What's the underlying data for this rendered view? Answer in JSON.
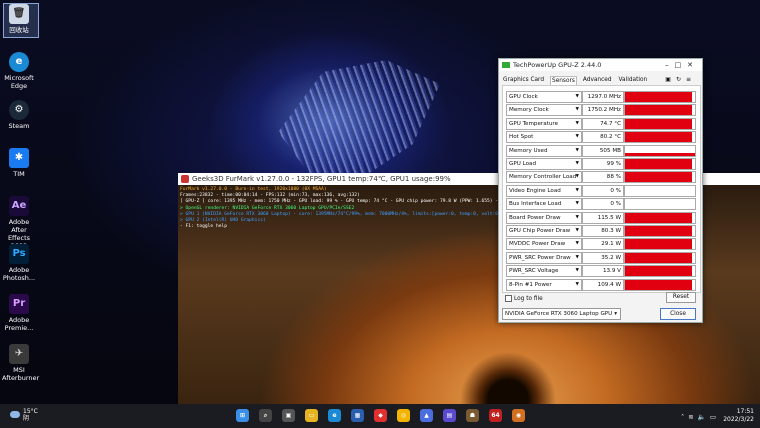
{
  "desktop": {
    "icons": [
      {
        "label": "回收站",
        "icon": "recycle-bin-icon"
      },
      {
        "label": "Microsoft Edge",
        "icon": "edge-icon",
        "color": "#1a8ad4"
      },
      {
        "label": "Steam",
        "icon": "steam-icon",
        "color": "#1b2838"
      },
      {
        "label": "TIM",
        "icon": "tim-icon",
        "color": "#1a7af0"
      },
      {
        "label": "Adobe After Effects 2022",
        "icon": "after-effects-icon",
        "color": "#1a0a3a",
        "glyph": "Ae"
      },
      {
        "label": "Adobe Photosh...",
        "icon": "photoshop-icon",
        "color": "#001e36",
        "glyph": "Ps"
      },
      {
        "label": "Adobe Premie...",
        "icon": "premiere-icon",
        "color": "#2a0a4a",
        "glyph": "Pr"
      },
      {
        "label": "MSI Afterburner",
        "icon": "msi-afterburner-icon",
        "color": "#444"
      }
    ]
  },
  "furmark": {
    "title": "Geeks3D FurMark v1.27.0.0 - 132FPS, GPU1 temp:74℃, GPU1 usage:99%",
    "osd": [
      {
        "text": "FurMark v1.27.0.0 - Burn-in test, 1920x1080 (0X MSAA)",
        "color": "#ffb030"
      },
      {
        "text": "Frames:23832 - time:00:04:14 - FPS:132 (min:73, max:136, avg:132)",
        "color": "#ffffff"
      },
      {
        "text": "[ GPU-Z ] core: 1395 MHz - mem: 1750 MHz - GPU load: 99 % - GPU temp: 74 °C - GPU chip power: 79.8 W (PPW: 1.655) - Board power: 115.8 W (PPW: 1.1",
        "color": "#ffffff"
      },
      {
        "text": "> OpenGL renderer: NVIDIA GeForce RTX 3060 Laptop GPU/PCIe/SSE2",
        "color": "#40ff80"
      },
      {
        "text": "> GPU 1 (NVIDIA GeForce RTX 3060 Laptop) - core: 1395MHz/74°C/99%, mem: 7000MHz/4%, limits:[power:0, temp:0, volt:0, OV:0]",
        "color": "#40a0ff"
      },
      {
        "text": "> GPU 2 (Intel(R) UHD Graphics)",
        "color": "#40a0ff"
      },
      {
        "text": "- F1: toggle help",
        "color": "#ffffff"
      }
    ]
  },
  "gpuz": {
    "title": "TechPowerUp GPU-Z 2.44.0",
    "tabs": [
      "Graphics Card",
      "Sensors",
      "Advanced",
      "Validation"
    ],
    "active_tab": "Sensors",
    "sensors": [
      {
        "label": "GPU Clock",
        "value": "1297.0 MHz",
        "fill": 0.95
      },
      {
        "label": "Memory Clock",
        "value": "1750.2 MHz",
        "fill": 0.95
      },
      {
        "label": "GPU Temperature",
        "value": "74.7 °C",
        "fill": 0.95
      },
      {
        "label": "Hot Spot",
        "value": "80.2 °C",
        "fill": 0.95
      },
      {
        "label": "Memory Used",
        "value": "505 MB",
        "fill": 0.08
      },
      {
        "label": "GPU Load",
        "value": "99 %",
        "fill": 0.95
      },
      {
        "label": "Memory Controller Load",
        "value": "88 %",
        "fill": 0.95
      },
      {
        "label": "Video Engine Load",
        "value": "0 %",
        "fill": 0
      },
      {
        "label": "Bus Interface Load",
        "value": "0 %",
        "fill": 0
      },
      {
        "label": "Board Power Draw",
        "value": "115.5 W",
        "fill": 0.95
      },
      {
        "label": "GPU Chip Power Draw",
        "value": "80.3 W",
        "fill": 0.95
      },
      {
        "label": "MVDDC Power Draw",
        "value": "29.1 W",
        "fill": 0.95
      },
      {
        "label": "PWR_SRC Power Draw",
        "value": "35.2 W",
        "fill": 0.95
      },
      {
        "label": "PWR_SRC Voltage",
        "value": "13.9 V",
        "fill": 0.95
      },
      {
        "label": "8-Pin #1 Power",
        "value": "109.4 W",
        "fill": 0.95
      }
    ],
    "log_label": "Log to file",
    "reset_label": "Reset",
    "gpu_select": "NVIDIA GeForce RTX 3060 Laptop GPU",
    "close_label": "Close",
    "bar_color": "#e00010"
  },
  "taskbar": {
    "weather_temp": "15°C",
    "weather_desc": "阴",
    "time": "17:51",
    "date": "2022/3/22",
    "apps": [
      "start-icon",
      "search-icon",
      "task-view-icon",
      "file-explorer-icon",
      "edge-icon",
      "store-icon",
      "app-red-icon",
      "chrome-icon",
      "app-blue-icon",
      "app-purple-icon",
      "app-game-icon",
      "gpu-z-icon",
      "furmark-icon"
    ]
  }
}
